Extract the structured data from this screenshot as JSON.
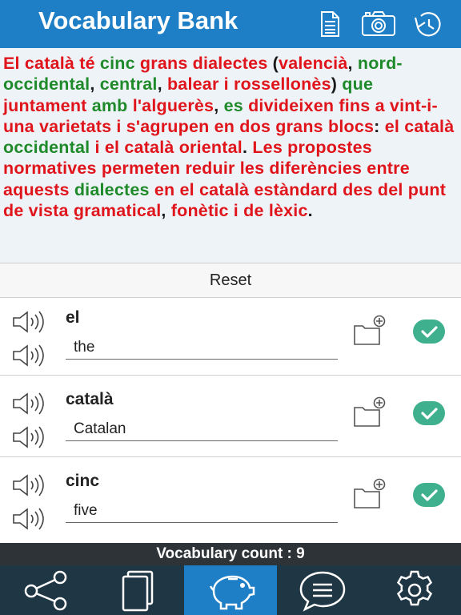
{
  "header": {
    "title": "Vocabulary Bank",
    "icons": [
      "document-icon",
      "camera-icon",
      "history-icon"
    ],
    "background_color": "#1f7fc6"
  },
  "passage": {
    "colors": {
      "red": "#e0141b",
      "green": "#1f8a2a",
      "dark": "#1a1a1a"
    },
    "segments": [
      {
        "t": "El català té ",
        "c": "red"
      },
      {
        "t": "cinc",
        "c": "green"
      },
      {
        "t": " grans dialectes ",
        "c": "red"
      },
      {
        "t": "(",
        "c": "dark"
      },
      {
        "t": "valencià",
        "c": "red"
      },
      {
        "t": ",",
        "c": "dark"
      },
      {
        "t": " nord-occidental",
        "c": "green"
      },
      {
        "t": ", ",
        "c": "dark"
      },
      {
        "t": "central",
        "c": "green"
      },
      {
        "t": ", ",
        "c": "dark"
      },
      {
        "t": "balear i rossellonès",
        "c": "red"
      },
      {
        "t": ") ",
        "c": "dark"
      },
      {
        "t": "que ",
        "c": "green"
      },
      {
        "t": "juntament ",
        "c": "red"
      },
      {
        "t": "amb ",
        "c": "green"
      },
      {
        "t": "l'alguerès",
        "c": "red"
      },
      {
        "t": ", ",
        "c": "dark"
      },
      {
        "t": "es ",
        "c": "green"
      },
      {
        "t": "divideixen fins a vint-i-una varietats i s'agrupen en dos grans blocs",
        "c": "red"
      },
      {
        "t": ": ",
        "c": "dark"
      },
      {
        "t": "el català ",
        "c": "red"
      },
      {
        "t": "occidental ",
        "c": "green"
      },
      {
        "t": "i el català oriental",
        "c": "red"
      },
      {
        "t": ". ",
        "c": "dark"
      },
      {
        "t": "Les propostes normatives permeten reduir les diferències entre aquests ",
        "c": "red"
      },
      {
        "t": "dialectes ",
        "c": "green"
      },
      {
        "t": "en el català estàndard des del punt de vista gramatical",
        "c": "red"
      },
      {
        "t": ", ",
        "c": "dark"
      },
      {
        "t": "fonètic i de lèxic",
        "c": "red"
      },
      {
        "t": ".",
        "c": "dark"
      }
    ]
  },
  "reset_label": "Reset",
  "cards": [
    {
      "word": "el",
      "translation": "the"
    },
    {
      "word": "català",
      "translation": "Catalan"
    },
    {
      "word": "cinc",
      "translation": "five"
    }
  ],
  "card_icons": [
    "speaker-icon",
    "folder-add-icon",
    "check-icon"
  ],
  "accent_check_color": "#3fb08e",
  "count_label": "Vocabulary count : 9",
  "tabbar": {
    "tabs": [
      {
        "icon": "share-icon",
        "active": false
      },
      {
        "icon": "cards-icon",
        "active": false
      },
      {
        "icon": "piggy-bank-icon",
        "active": true
      },
      {
        "icon": "chat-icon",
        "active": false
      },
      {
        "icon": "gear-icon",
        "active": false
      }
    ],
    "active_color": "#1f7fc6",
    "background_color": "#1f3644"
  }
}
